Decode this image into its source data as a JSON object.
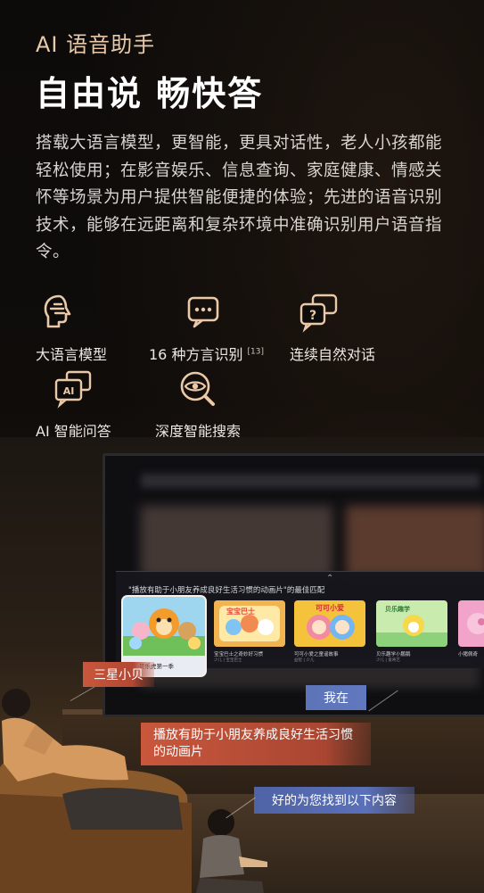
{
  "hero": {
    "subtitle": "AI 语音助手",
    "title": "自由说 畅快答",
    "description": "搭载大语言模型，更智能，更具对话性，老人小孩都能轻松使用；在影音娱乐、信息查询、家庭健康、情感关怀等场景为用户提供智能便捷的体验；先进的语音识别技术，能够在远距离和复杂环境中准确识别用户语音指令。"
  },
  "features": [
    {
      "icon": "brain-head-icon",
      "label": "大语言模型"
    },
    {
      "icon": "chat-dots-icon",
      "label": "16 种方言识别",
      "note": "[13]"
    },
    {
      "icon": "question-chat-icon",
      "label": "连续自然对话"
    },
    {
      "icon": "ai-chat-icon",
      "label": "AI 智能问答"
    },
    {
      "icon": "eye-search-icon",
      "label": "深度智能搜索"
    }
  ],
  "tv_panel": {
    "prompt": "\"播放有助于小朋友养成良好生活习惯的动画片\"的最佳匹配",
    "cards": [
      {
        "caption": "萌！贝乐虎第一季",
        "sub": ""
      },
      {
        "caption": "宝宝巴士之奇妙好习惯",
        "sub": "少儿 | 宝宝巴士"
      },
      {
        "caption": "可可小爱之童谣故事",
        "sub": "益智 | 少儿"
      },
      {
        "caption": "贝乐趣学小鹏鹅",
        "sub": "少儿 | 爱奇艺"
      },
      {
        "caption": "小猪佩奇",
        "sub": ""
      }
    ]
  },
  "dialogue": {
    "samsung": "三星小贝",
    "me": "我在",
    "request": "播放有助于小朋友养成良好生活习惯的动画片",
    "reply": "好的为您找到以下内容"
  },
  "colors": {
    "accent_warm": "#e9c9a7",
    "bubble_orange": "#c9573c",
    "bubble_blue": "#5e74b8"
  }
}
